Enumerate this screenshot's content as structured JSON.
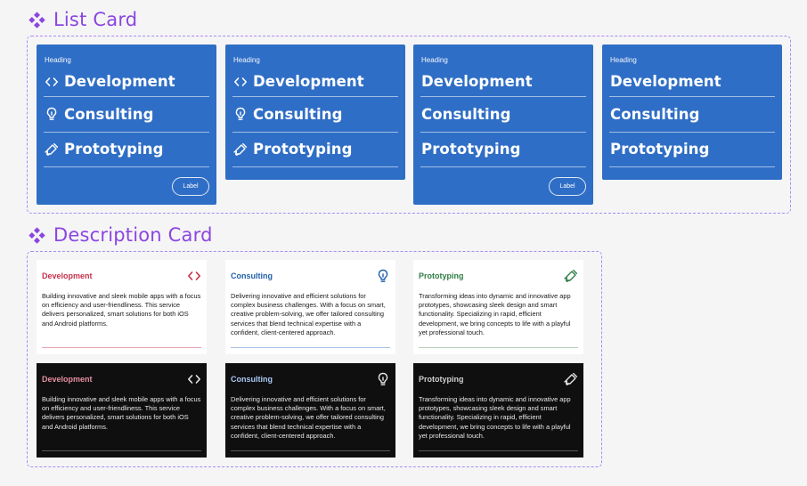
{
  "sections": {
    "list_title": "List Card",
    "description_title": "Description Card"
  },
  "colors": {
    "accent": "#8b46e0",
    "card_blue": "#2f6ec6",
    "development": "#c4314b",
    "consulting": "#1f5fa8",
    "prototyping": "#2f7d44"
  },
  "list_cards": [
    {
      "heading": "Heading",
      "items": [
        {
          "label": "Development",
          "icon": "code-icon"
        },
        {
          "label": "Consulting",
          "icon": "lightbulb-icon"
        },
        {
          "label": "Prototyping",
          "icon": "pen-swirl-icon"
        }
      ],
      "button_label": "Label"
    },
    {
      "heading": "Heading",
      "items": [
        {
          "label": "Development",
          "icon": "code-icon"
        },
        {
          "label": "Consulting",
          "icon": "lightbulb-icon"
        },
        {
          "label": "Prototyping",
          "icon": "pen-swirl-icon"
        }
      ]
    },
    {
      "heading": "Heading",
      "items": [
        {
          "label": "Development"
        },
        {
          "label": "Consulting"
        },
        {
          "label": "Prototyping"
        }
      ],
      "button_label": "Label"
    },
    {
      "heading": "Heading",
      "items": [
        {
          "label": "Development"
        },
        {
          "label": "Consulting"
        },
        {
          "label": "Prototyping"
        }
      ]
    }
  ],
  "description_cards": {
    "development": {
      "title": "Development",
      "icon": "code-icon",
      "body": "Building innovative and sleek mobile apps with a focus on efficiency and user-friendliness. This service delivers personalized, smart solutions for both iOS and Android platforms."
    },
    "consulting": {
      "title": "Consulting",
      "icon": "lightbulb-icon",
      "body": "Delivering innovative and efficient solutions for complex business challenges. With a focus on smart, creative problem-solving, we offer tailored consulting services that blend technical expertise with a confident, client-centered approach."
    },
    "prototyping": {
      "title": "Prototyping",
      "icon": "pen-swirl-icon",
      "body": "Transforming ideas into dynamic and innovative app prototypes, showcasing sleek design and smart functionality. Specializing in rapid, efficient development, we bring concepts to life with a playful yet professional touch."
    }
  }
}
